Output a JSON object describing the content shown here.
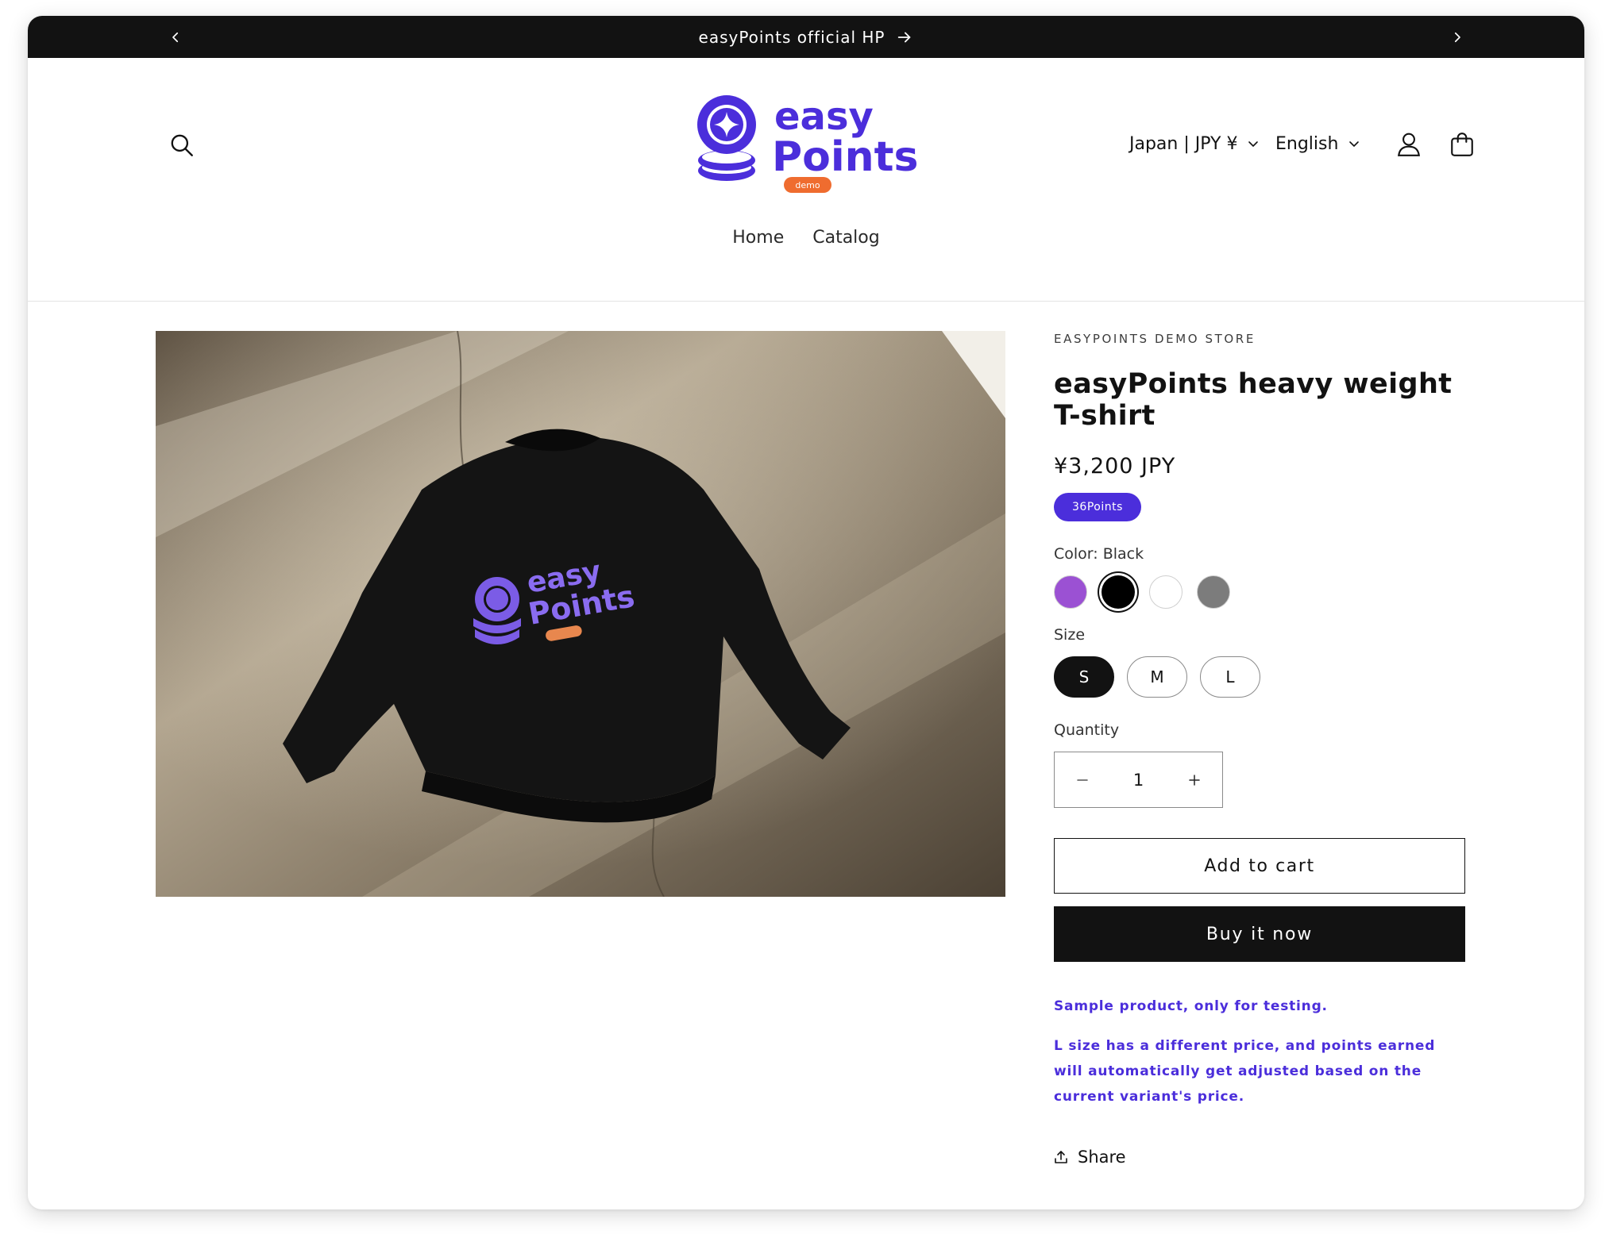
{
  "announcement": {
    "text": "easyPoints official HP",
    "prev_icon": "chevron-left-icon",
    "next_icon": "chevron-right-icon",
    "link_icon": "arrow-right-icon"
  },
  "header": {
    "logo": {
      "line1": "easy",
      "line2": "Points",
      "tag": "demo",
      "brand_color": "#4b2edb",
      "tag_color": "#ef6c2f"
    },
    "country_selector": "Japan | JPY ¥",
    "language_selector": "English",
    "icons": [
      "search-icon",
      "account-icon",
      "cart-icon"
    ]
  },
  "nav": {
    "items": [
      {
        "label": "Home"
      },
      {
        "label": "Catalog"
      }
    ]
  },
  "product": {
    "vendor": "EASYPOINTS DEMO STORE",
    "title": "easyPoints heavy weight T-shirt",
    "price": "¥3,200 JPY",
    "points_badge": "36Points",
    "color_label": "Color: Black",
    "colors": [
      {
        "name": "Purple",
        "hex": "#9b51d3",
        "selected": false
      },
      {
        "name": "Black",
        "hex": "#000000",
        "selected": true
      },
      {
        "name": "White",
        "hex": "#ffffff",
        "selected": false
      },
      {
        "name": "Gray",
        "hex": "#7c7c7c",
        "selected": false
      }
    ],
    "size_label": "Size",
    "sizes": [
      {
        "label": "S",
        "selected": true
      },
      {
        "label": "M",
        "selected": false
      },
      {
        "label": "L",
        "selected": false
      }
    ],
    "quantity_label": "Quantity",
    "quantity_value": "1",
    "add_to_cart": "Add to cart",
    "buy_now": "Buy it now",
    "description": [
      "Sample product, only for testing.",
      "L size has a different price, and points earned will automatically get adjusted based on the current variant's price."
    ],
    "share": "Share",
    "image": {
      "print_line1": "easy",
      "print_line2": "Points"
    }
  },
  "colors": {
    "accent": "#4b2edb",
    "dark": "#121212"
  }
}
